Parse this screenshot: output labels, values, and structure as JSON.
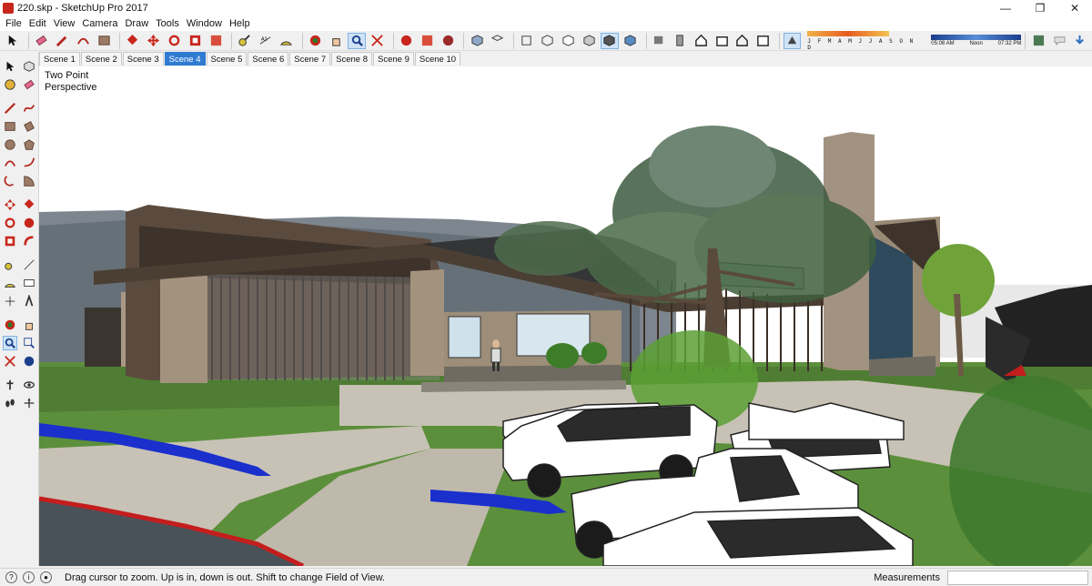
{
  "window": {
    "title": "220.skp - SketchUp Pro 2017",
    "controls": [
      "—",
      "❐",
      "✕"
    ]
  },
  "menu": [
    "File",
    "Edit",
    "View",
    "Camera",
    "Draw",
    "Tools",
    "Window",
    "Help"
  ],
  "shadow_settings": {
    "months": "J F M A M J J A S O N D",
    "time_start": "05:08 AM",
    "time_mid": "Noon",
    "time_end": "07:32 PM"
  },
  "scenes": [
    "Scene 1",
    "Scene 2",
    "Scene 3",
    "Scene 4",
    "Scene 5",
    "Scene 6",
    "Scene 7",
    "Scene 8",
    "Scene 9",
    "Scene 10"
  ],
  "active_scene": "Scene 4",
  "viewport": {
    "camera_label_1": "Two Point",
    "camera_label_2": "Perspective"
  },
  "status": {
    "message": "Drag cursor to zoom.  Up is in, down is out. Shift to change Field of View.",
    "measurements_label": "Measurements",
    "measurements_value": ""
  },
  "toolbar_icons": [
    "select-icon",
    "eraser-icon",
    "pencil-icon",
    "arc-icon",
    "rectangle-icon",
    "push-pull-icon",
    "move-icon",
    "rotate-icon",
    "scale-icon",
    "offset-icon",
    "tape-measure-icon",
    "dimension-icon",
    "protractor-icon",
    "text-icon",
    "axes-icon",
    "3d-text-icon",
    "orbit-icon",
    "pan-icon",
    "zoom-icon",
    "zoom-extents-icon",
    "warehouse-icon",
    "extension-icon",
    "layout-icon",
    "iso-view-icon",
    "top-view-icon",
    "front-view-icon",
    "right-view-icon",
    "back-view-icon",
    "left-view-icon",
    "xray-icon",
    "wireframe-icon",
    "hidden-line-icon",
    "shaded-icon",
    "shaded-texture-icon",
    "monochrome-icon",
    "shadows-toggle-icon",
    "section-plane-icon",
    "section-display-icon",
    "section-cut-icon"
  ],
  "colors": {
    "accent": "#2f7bd2",
    "sky": "#ffffff",
    "grass": "#5c8f3c",
    "path": "#c7c2b5",
    "water": "#1a2fcc",
    "curb": "#c41d1d",
    "roof": "#5a4a3d"
  }
}
